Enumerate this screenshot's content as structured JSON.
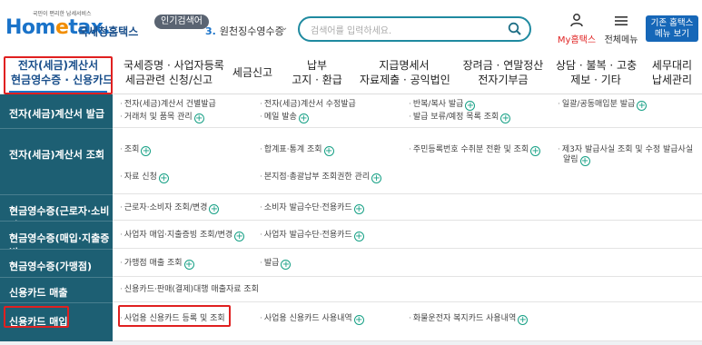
{
  "header": {
    "logo_sub": "국민이 편리한 납세서비스",
    "logo_pre": "Hom",
    "logo_e": "e",
    "logo_post": "tax.",
    "logo_kor": "국세청홈택스",
    "popular_badge": "인기검색어",
    "popular_rank": "3.",
    "popular_term": "원천징수영수증",
    "search_placeholder": "검색어를 입력하세요.",
    "myhome_label": "My홈택스",
    "allmenu_label": "전체메뉴",
    "basic_btn_line1": "기존 홈택스",
    "basic_btn_line2": "메뉴 보기"
  },
  "nav": [
    {
      "line1": "전자(세금)계산서",
      "line2": "현금영수증 · 신용카드",
      "active": true
    },
    {
      "line1": "국세증명 · 사업자등록",
      "line2": "세금관련 신청/신고"
    },
    {
      "line1": "세금신고",
      "line2": ""
    },
    {
      "line1": "납부",
      "line2": "고지 · 환급"
    },
    {
      "line1": "지급명세서",
      "line2": "자료제출 · 공익법인"
    },
    {
      "line1": "장려금 · 연말정산",
      "line2": "전자기부금"
    },
    {
      "line1": "상담 · 불복 · 고충",
      "line2": "제보 · 기타"
    },
    {
      "line1": "세무대리",
      "line2": "납세관리"
    }
  ],
  "menu": [
    {
      "head": "전자(세금)계산서 발급",
      "cells": [
        {
          "text": "전자(세금)계산서 건별발급",
          "plus": false
        },
        {
          "text": "거래처 및 품목 관리",
          "plus": true
        },
        {
          "text": "전자(세금)계산서 수정발급",
          "plus": false
        },
        {
          "text": "메일 발송",
          "plus": true
        },
        {
          "text": "반복/복사 발급",
          "plus": true
        },
        {
          "text": "발급 보류/예정 목록 조회",
          "plus": true
        },
        {
          "text": "일괄/공동매입분 발급",
          "plus": true
        }
      ]
    },
    {
      "head": "전자(세금)계산서 조회",
      "cells": [
        {
          "text": "조회",
          "plus": true
        },
        {
          "text": "자료 신청",
          "plus": true
        },
        {
          "text": "합계표·통계 조회",
          "plus": true
        },
        {
          "text": "본지점·총괄납부 조회권한 관리",
          "plus": true
        },
        {
          "text": "주민등록번호 수취분 전환 및 조회",
          "plus": true
        },
        {
          "text": "제3자 발급사실 조회 및 수정 발급사실",
          "plus": false
        },
        {
          "text": "알림",
          "plus": true
        }
      ]
    },
    {
      "head": "현금영수증(근로자·소비자)",
      "cells": [
        {
          "text": "근로자·소비자 조회/변경",
          "plus": true
        },
        {
          "text": "소비자 발급수단·전용카드",
          "plus": true
        }
      ]
    },
    {
      "head": "현금영수증(매입·지출증빙)",
      "cells": [
        {
          "text": "사업자 매입·지출증빙 조회/변경",
          "plus": true
        },
        {
          "text": "사업자 발급수단·전용카드",
          "plus": true
        }
      ]
    },
    {
      "head": "현금영수증(가맹점)",
      "cells": [
        {
          "text": "가맹점 매출 조회",
          "plus": true
        },
        {
          "text": "발급",
          "plus": true
        }
      ]
    },
    {
      "head": "신용카드 매출",
      "cells": [
        {
          "text": "신용카드·판매(결제)대행 매출자료 조회",
          "plus": false
        }
      ]
    },
    {
      "head": "신용카드 매입",
      "cells": [
        {
          "text": "사업용 신용카드 등록 및 조회",
          "plus": false
        },
        {
          "text": "사업용 신용카드 사용내역",
          "plus": true
        },
        {
          "text": "화물운전자 복지카드 사용내역",
          "plus": true
        }
      ]
    }
  ],
  "colors": {
    "accent": "#1a73c9",
    "sidebar": "#1d5f73",
    "highlight": "#e02020",
    "plus": "#16a085"
  }
}
